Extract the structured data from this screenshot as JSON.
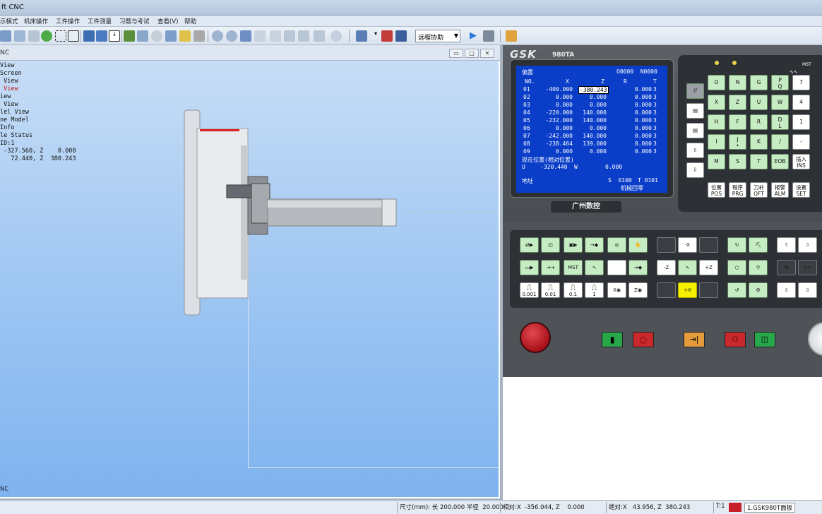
{
  "window": {
    "title": "ft CNC"
  },
  "menu": [
    "示模式",
    "机床操作",
    "工件操作",
    "工件测量",
    "习题与考试",
    "查看(V)",
    "帮助"
  ],
  "toolbar": {
    "remote_assist": "远程协助"
  },
  "view_window": {
    "title": "NC",
    "footer_label": "NC",
    "overlay_lines": [
      "View",
      "Screen",
      " View",
      " View",
      "iew",
      " View",
      "lel View",
      "ne Model",
      "Info",
      "le Status",
      "ID:1",
      " -327.560, Z    0.000",
      "   72.440, Z  380.243"
    ],
    "highlighted_line_index": 3,
    "winbtn_min": "▭",
    "winbtn_max": "□",
    "winbtn_close": "✕"
  },
  "status_bar": {
    "size": "尺寸(mm): 长 200.000 半径  20.000",
    "relative": "相对:X  -356.044, Z    0.000",
    "absolute": "绝对:X   43.956, Z  380.243",
    "tool": "T:1",
    "panel": "1.GSK980T面板"
  },
  "cnc": {
    "brand": "GSK",
    "model": "980TA",
    "maker": "广州数控",
    "screen": {
      "title": "偏置",
      "program": "O0000  N0000",
      "headers": [
        "NO.",
        "X",
        "Z",
        "R",
        "T"
      ],
      "rows": [
        [
          "01",
          "-400.000",
          "-380.243",
          "0.000",
          "3"
        ],
        [
          "02",
          "0.000",
          "0.000",
          "0.000",
          "3"
        ],
        [
          "03",
          "0.000",
          "0.000",
          "0.000",
          "3"
        ],
        [
          "04",
          "-220.000",
          "140.000",
          "0.000",
          "3"
        ],
        [
          "05",
          "-232.000",
          "140.000",
          "0.000",
          "3"
        ],
        [
          "06",
          "0.000",
          "0.000",
          "0.000",
          "3"
        ],
        [
          "07",
          "-242.000",
          "140.000",
          "0.000",
          "3"
        ],
        [
          "08",
          "-238.464",
          "139.000",
          "0.000",
          "3"
        ],
        [
          "09",
          "0.000",
          "0.000",
          "0.000",
          "3"
        ]
      ],
      "pos_label": "现在位置(相对位置)",
      "u_label": "U",
      "u_value": "-320.440",
      "w_label": "W",
      "w_value": "0.000",
      "addr_label": "地址",
      "s_value": "S  0100",
      "t_value": "T 0101",
      "mode": "机械回零"
    },
    "keys": {
      "row1": [
        "O",
        "N",
        "G",
        "P\nQ",
        "7"
      ],
      "row2": [
        "X",
        "Z",
        "U",
        "W",
        "4"
      ],
      "row3": [
        "H",
        "F",
        "R",
        "D\nL",
        "1"
      ],
      "row4": [
        "I",
        "J\n•",
        "K",
        "/",
        "-"
      ],
      "row5": [
        "M",
        "S",
        "T",
        "EOB"
      ],
      "insert": "插入\nINS",
      "func": [
        "位置\nPOS",
        "程序\nPRG",
        "刀补\nOFT",
        "报警\nALM",
        "设置\nSET"
      ]
    },
    "jog": {
      "minus_x": "-X",
      "minus_z": "-Z",
      "plus_z": "+Z",
      "plus_x": "+X"
    },
    "steps": [
      "0.001",
      "0.01",
      "0.1",
      "1"
    ],
    "x_label": "X◉",
    "z_label": "Z◉",
    "mst_label": "MST",
    "colors": {
      "lcd": "#0a3ec8",
      "key_green": "#c6ecc4",
      "yellow": "#f4f000",
      "estop": "#b3161f"
    }
  }
}
